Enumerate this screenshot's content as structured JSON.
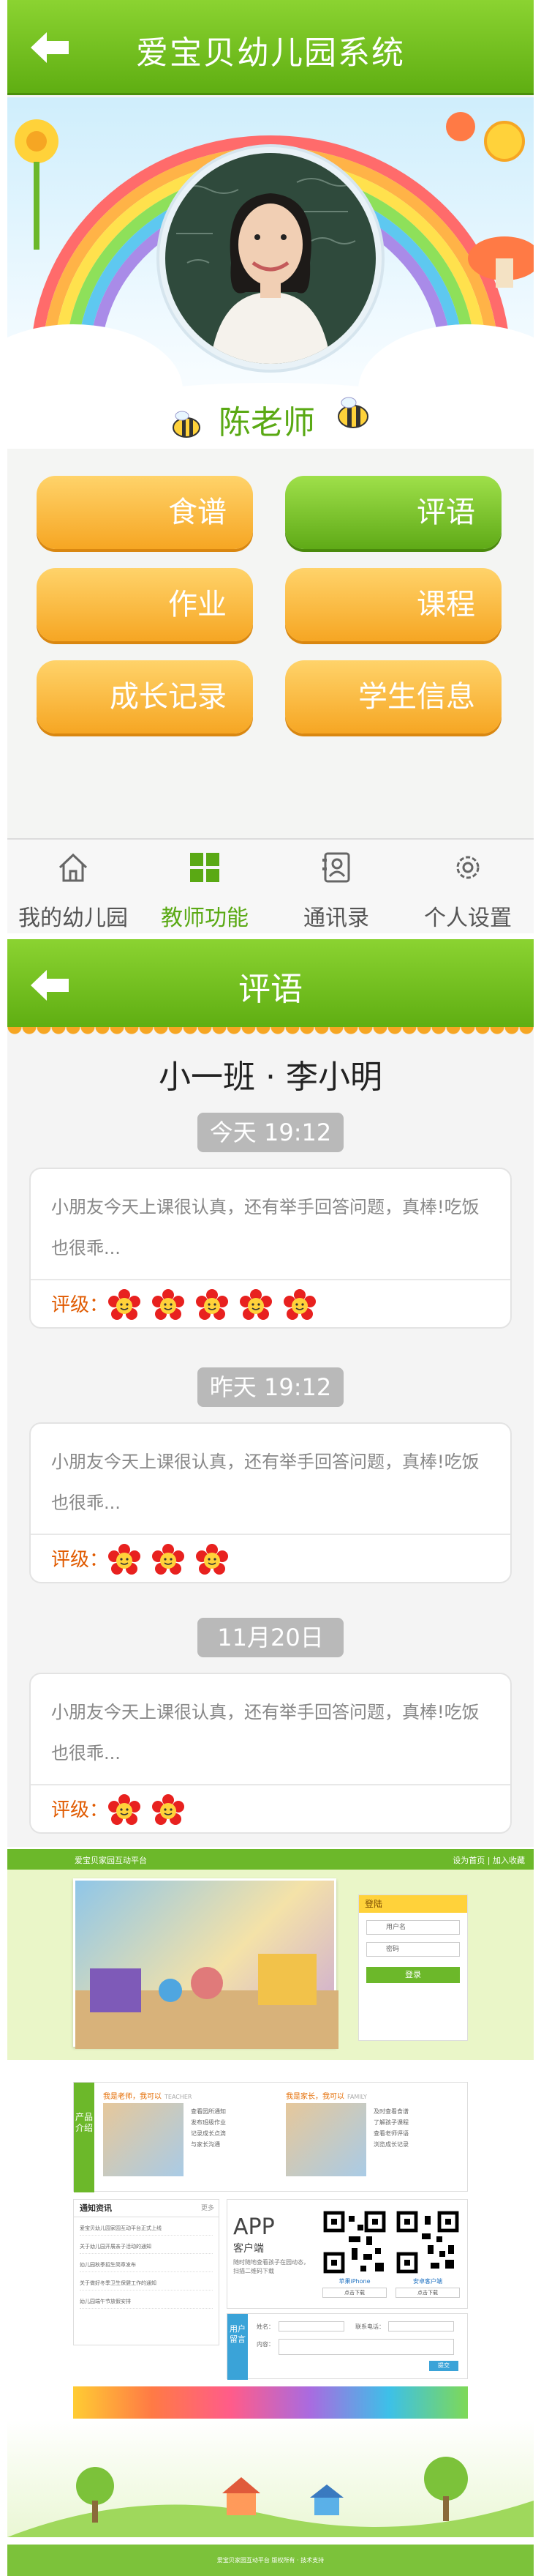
{
  "colors": {
    "green": "#6cb82a",
    "green_dark": "#4b8f0b",
    "orange": "#f6a623",
    "teacher_name": "#5aa914",
    "rating_label": "#e05a00",
    "date_pill": "#b9b9b9"
  },
  "home": {
    "title": "爱宝贝幼儿园系统",
    "back_icon": "back-arrow-icon",
    "teacher_name": "陈老师",
    "menu": [
      {
        "label": "食谱",
        "style": "orange"
      },
      {
        "label": "评语",
        "style": "green"
      },
      {
        "label": "作业",
        "style": "orange"
      },
      {
        "label": "课程",
        "style": "orange"
      },
      {
        "label": "成长记录",
        "style": "orange"
      },
      {
        "label": "学生信息",
        "style": "orange"
      }
    ],
    "tabs": [
      {
        "label": "我的幼儿园",
        "icon": "home-icon",
        "active": false
      },
      {
        "label": "教师功能",
        "icon": "grid-icon",
        "active": true
      },
      {
        "label": "通讯录",
        "icon": "contacts-icon",
        "active": false
      },
      {
        "label": "个人设置",
        "icon": "gear-icon",
        "active": false
      }
    ]
  },
  "comments": {
    "title": "评语",
    "student": "小一班 · 李小明",
    "rating_label": "评级：",
    "entries": [
      {
        "date": "今天  19:12",
        "text": "小朋友今天上课很认真，还有举手回答问题，真棒!吃饭也很乖...",
        "rating": 5
      },
      {
        "date": "昨天  19:12",
        "text": "小朋友今天上课很认真，还有举手回答问题，真棒!吃饭也很乖...",
        "rating": 3
      },
      {
        "date": "11月20日",
        "text": "小朋友今天上课很认真，还有举手回答问题，真棒!吃饭也很乖...",
        "rating": 2
      }
    ]
  },
  "web": {
    "top_left": "爱宝贝家园互动平台",
    "top_right": "设为首页 | 加入收藏",
    "login_title": "登陆",
    "login_user_placeholder": "用户名",
    "login_pass_placeholder": "密码",
    "login_button": "登录",
    "side_intro": "产品介绍",
    "teacher_title": "我是老师，我可以",
    "teacher_en": "TEACHER",
    "teacher_items": [
      "查看园所通知",
      "发布班级作业",
      "记录成长点滴",
      "与家长沟通"
    ],
    "family_title": "我是家长，我可以",
    "family_en": "FAMILY",
    "family_items": [
      "及时查看食谱",
      "了解孩子课程",
      "查看老师评语",
      "浏览成长记录"
    ],
    "notice_title": "通知资讯",
    "notice_more": "更多",
    "notice_rows": [
      "爱宝贝幼儿园家园互动平台正式上线",
      "关于幼儿园开展亲子活动的通知",
      "幼儿园秋季招生简章发布",
      "关于做好冬季卫生保健工作的通知",
      "幼儿园端午节放假安排"
    ],
    "app_big": "APP",
    "app_sub": "客户端",
    "app_desc": "随时随地查看孩子在园动态，扫描二维码下载",
    "app_iphone": "苹果iPhone",
    "app_android": "安卓客户端",
    "app_download": "点击下载",
    "msg_side": "用户留言",
    "msg_name": "姓名：",
    "msg_phone": "联系电话：",
    "msg_content": "内容：",
    "msg_submit": "提交",
    "footer": "爱宝贝家园互动平台 版权所有 · 技术支持"
  }
}
